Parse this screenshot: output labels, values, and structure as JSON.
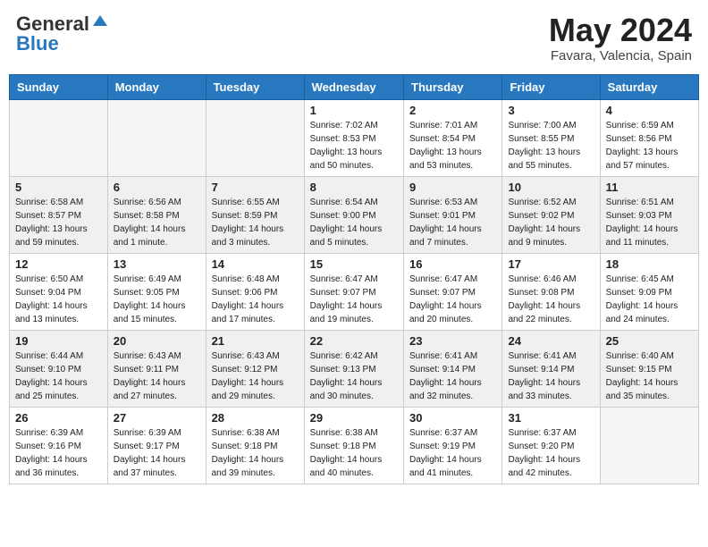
{
  "header": {
    "logo_general": "General",
    "logo_blue": "Blue",
    "title": "May 2024",
    "location": "Favara, Valencia, Spain"
  },
  "days_of_week": [
    "Sunday",
    "Monday",
    "Tuesday",
    "Wednesday",
    "Thursday",
    "Friday",
    "Saturday"
  ],
  "weeks": [
    [
      {
        "day": "",
        "sunrise": "",
        "sunset": "",
        "daylight": "",
        "empty": true
      },
      {
        "day": "",
        "sunrise": "",
        "sunset": "",
        "daylight": "",
        "empty": true
      },
      {
        "day": "",
        "sunrise": "",
        "sunset": "",
        "daylight": "",
        "empty": true
      },
      {
        "day": "1",
        "sunrise": "Sunrise: 7:02 AM",
        "sunset": "Sunset: 8:53 PM",
        "daylight": "Daylight: 13 hours and 50 minutes."
      },
      {
        "day": "2",
        "sunrise": "Sunrise: 7:01 AM",
        "sunset": "Sunset: 8:54 PM",
        "daylight": "Daylight: 13 hours and 53 minutes."
      },
      {
        "day": "3",
        "sunrise": "Sunrise: 7:00 AM",
        "sunset": "Sunset: 8:55 PM",
        "daylight": "Daylight: 13 hours and 55 minutes."
      },
      {
        "day": "4",
        "sunrise": "Sunrise: 6:59 AM",
        "sunset": "Sunset: 8:56 PM",
        "daylight": "Daylight: 13 hours and 57 minutes."
      }
    ],
    [
      {
        "day": "5",
        "sunrise": "Sunrise: 6:58 AM",
        "sunset": "Sunset: 8:57 PM",
        "daylight": "Daylight: 13 hours and 59 minutes."
      },
      {
        "day": "6",
        "sunrise": "Sunrise: 6:56 AM",
        "sunset": "Sunset: 8:58 PM",
        "daylight": "Daylight: 14 hours and 1 minute."
      },
      {
        "day": "7",
        "sunrise": "Sunrise: 6:55 AM",
        "sunset": "Sunset: 8:59 PM",
        "daylight": "Daylight: 14 hours and 3 minutes."
      },
      {
        "day": "8",
        "sunrise": "Sunrise: 6:54 AM",
        "sunset": "Sunset: 9:00 PM",
        "daylight": "Daylight: 14 hours and 5 minutes."
      },
      {
        "day": "9",
        "sunrise": "Sunrise: 6:53 AM",
        "sunset": "Sunset: 9:01 PM",
        "daylight": "Daylight: 14 hours and 7 minutes."
      },
      {
        "day": "10",
        "sunrise": "Sunrise: 6:52 AM",
        "sunset": "Sunset: 9:02 PM",
        "daylight": "Daylight: 14 hours and 9 minutes."
      },
      {
        "day": "11",
        "sunrise": "Sunrise: 6:51 AM",
        "sunset": "Sunset: 9:03 PM",
        "daylight": "Daylight: 14 hours and 11 minutes."
      }
    ],
    [
      {
        "day": "12",
        "sunrise": "Sunrise: 6:50 AM",
        "sunset": "Sunset: 9:04 PM",
        "daylight": "Daylight: 14 hours and 13 minutes."
      },
      {
        "day": "13",
        "sunrise": "Sunrise: 6:49 AM",
        "sunset": "Sunset: 9:05 PM",
        "daylight": "Daylight: 14 hours and 15 minutes."
      },
      {
        "day": "14",
        "sunrise": "Sunrise: 6:48 AM",
        "sunset": "Sunset: 9:06 PM",
        "daylight": "Daylight: 14 hours and 17 minutes."
      },
      {
        "day": "15",
        "sunrise": "Sunrise: 6:47 AM",
        "sunset": "Sunset: 9:07 PM",
        "daylight": "Daylight: 14 hours and 19 minutes."
      },
      {
        "day": "16",
        "sunrise": "Sunrise: 6:47 AM",
        "sunset": "Sunset: 9:07 PM",
        "daylight": "Daylight: 14 hours and 20 minutes."
      },
      {
        "day": "17",
        "sunrise": "Sunrise: 6:46 AM",
        "sunset": "Sunset: 9:08 PM",
        "daylight": "Daylight: 14 hours and 22 minutes."
      },
      {
        "day": "18",
        "sunrise": "Sunrise: 6:45 AM",
        "sunset": "Sunset: 9:09 PM",
        "daylight": "Daylight: 14 hours and 24 minutes."
      }
    ],
    [
      {
        "day": "19",
        "sunrise": "Sunrise: 6:44 AM",
        "sunset": "Sunset: 9:10 PM",
        "daylight": "Daylight: 14 hours and 25 minutes."
      },
      {
        "day": "20",
        "sunrise": "Sunrise: 6:43 AM",
        "sunset": "Sunset: 9:11 PM",
        "daylight": "Daylight: 14 hours and 27 minutes."
      },
      {
        "day": "21",
        "sunrise": "Sunrise: 6:43 AM",
        "sunset": "Sunset: 9:12 PM",
        "daylight": "Daylight: 14 hours and 29 minutes."
      },
      {
        "day": "22",
        "sunrise": "Sunrise: 6:42 AM",
        "sunset": "Sunset: 9:13 PM",
        "daylight": "Daylight: 14 hours and 30 minutes."
      },
      {
        "day": "23",
        "sunrise": "Sunrise: 6:41 AM",
        "sunset": "Sunset: 9:14 PM",
        "daylight": "Daylight: 14 hours and 32 minutes."
      },
      {
        "day": "24",
        "sunrise": "Sunrise: 6:41 AM",
        "sunset": "Sunset: 9:14 PM",
        "daylight": "Daylight: 14 hours and 33 minutes."
      },
      {
        "day": "25",
        "sunrise": "Sunrise: 6:40 AM",
        "sunset": "Sunset: 9:15 PM",
        "daylight": "Daylight: 14 hours and 35 minutes."
      }
    ],
    [
      {
        "day": "26",
        "sunrise": "Sunrise: 6:39 AM",
        "sunset": "Sunset: 9:16 PM",
        "daylight": "Daylight: 14 hours and 36 minutes."
      },
      {
        "day": "27",
        "sunrise": "Sunrise: 6:39 AM",
        "sunset": "Sunset: 9:17 PM",
        "daylight": "Daylight: 14 hours and 37 minutes."
      },
      {
        "day": "28",
        "sunrise": "Sunrise: 6:38 AM",
        "sunset": "Sunset: 9:18 PM",
        "daylight": "Daylight: 14 hours and 39 minutes."
      },
      {
        "day": "29",
        "sunrise": "Sunrise: 6:38 AM",
        "sunset": "Sunset: 9:18 PM",
        "daylight": "Daylight: 14 hours and 40 minutes."
      },
      {
        "day": "30",
        "sunrise": "Sunrise: 6:37 AM",
        "sunset": "Sunset: 9:19 PM",
        "daylight": "Daylight: 14 hours and 41 minutes."
      },
      {
        "day": "31",
        "sunrise": "Sunrise: 6:37 AM",
        "sunset": "Sunset: 9:20 PM",
        "daylight": "Daylight: 14 hours and 42 minutes."
      },
      {
        "day": "",
        "sunrise": "",
        "sunset": "",
        "daylight": "",
        "empty": true
      }
    ]
  ]
}
